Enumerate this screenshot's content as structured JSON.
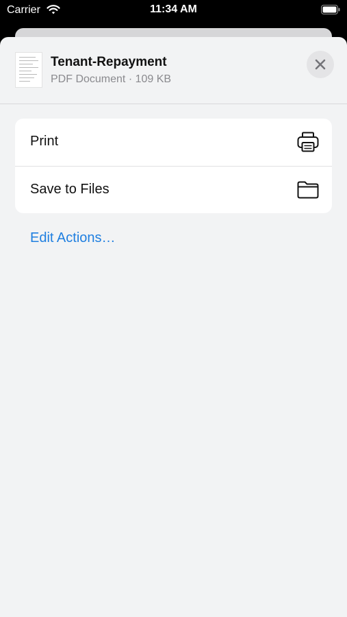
{
  "status_bar": {
    "carrier": "Carrier",
    "time": "11:34 AM"
  },
  "share_sheet": {
    "document": {
      "title": "Tenant-Repayment",
      "subtitle": "PDF Document · 109 KB"
    },
    "actions": [
      {
        "label": "Print",
        "icon": "printer-icon"
      },
      {
        "label": "Save to Files",
        "icon": "folder-icon"
      }
    ],
    "edit_actions_label": "Edit Actions…"
  },
  "colors": {
    "accent": "#1f7fe0",
    "sheet_background": "#f2f3f4"
  }
}
